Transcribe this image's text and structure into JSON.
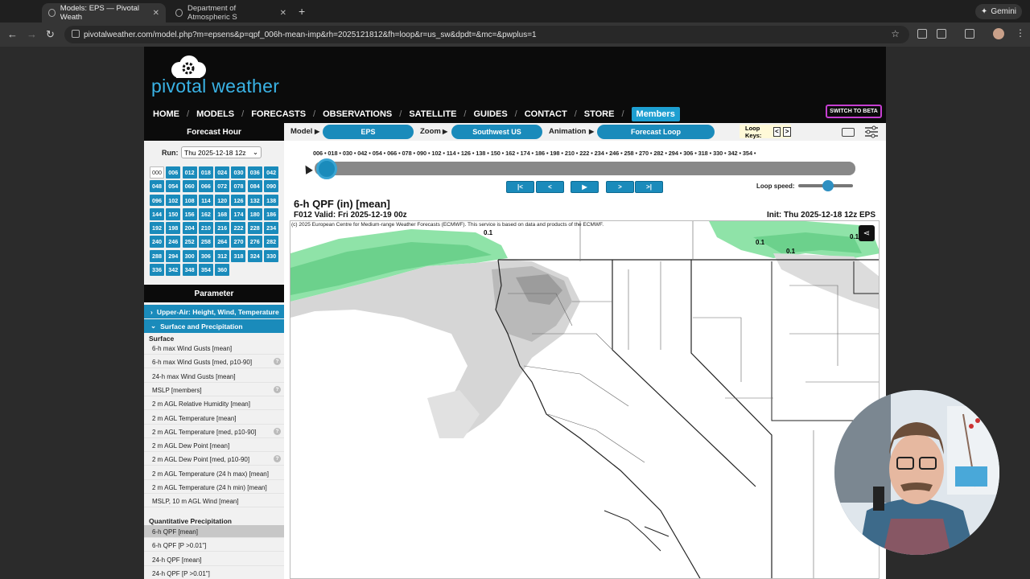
{
  "browser": {
    "tabs": [
      {
        "title": "Models: EPS — Pivotal Weath",
        "active": true
      },
      {
        "title": "Department of Atmospheric S",
        "active": false
      }
    ],
    "gemini_label": "Gemini",
    "url": "pivotalweather.com/model.php?m=epsens&p=qpf_006h-mean-imp&rh=2025121812&fh=loop&r=us_sw&dpdt=&mc=&pwplus=1"
  },
  "site": {
    "logo_text": "pivotal weather",
    "nav": [
      "HOME",
      "MODELS",
      "FORECASTS",
      "OBSERVATIONS",
      "SATELLITE",
      "GUIDES",
      "CONTACT",
      "STORE"
    ],
    "members_label": "Members",
    "switch_beta_label": "SWITCH TO BETA"
  },
  "left_panel": {
    "forecast_hour_title": "Forecast Hour",
    "run_label": "Run:",
    "run_value": "Thu 2025-12-18 12z",
    "hours": [
      "000",
      "006",
      "012",
      "018",
      "024",
      "030",
      "036",
      "042",
      "048",
      "054",
      "060",
      "066",
      "072",
      "078",
      "084",
      "090",
      "096",
      "102",
      "108",
      "114",
      "120",
      "126",
      "132",
      "138",
      "144",
      "150",
      "156",
      "162",
      "168",
      "174",
      "180",
      "186",
      "192",
      "198",
      "204",
      "210",
      "216",
      "222",
      "228",
      "234",
      "240",
      "246",
      "252",
      "258",
      "264",
      "270",
      "276",
      "282",
      "288",
      "294",
      "300",
      "306",
      "312",
      "318",
      "324",
      "330",
      "336",
      "342",
      "348",
      "354",
      "360"
    ],
    "current_hour": "000",
    "parameter_title": "Parameter",
    "categories": [
      {
        "label": "Upper-Air: Height, Wind, Temperature",
        "expanded": false
      },
      {
        "label": "Surface and Precipitation",
        "expanded": true
      }
    ],
    "surface_heading": "Surface",
    "surface_items": [
      {
        "label": "6-h max Wind Gusts [mean]",
        "help": false
      },
      {
        "label": "6-h max Wind Gusts [med, p10-90]",
        "help": true
      },
      {
        "label": "24-h max Wind Gusts [mean]",
        "help": false
      },
      {
        "label": "MSLP [members]",
        "help": true
      },
      {
        "label": "2 m AGL Relative Humidity [mean]",
        "help": false
      },
      {
        "label": "2 m AGL Temperature [mean]",
        "help": false
      },
      {
        "label": "2 m AGL Temperature [med, p10-90]",
        "help": true
      },
      {
        "label": "2 m AGL Dew Point [mean]",
        "help": false
      },
      {
        "label": "2 m AGL Dew Point [med, p10-90]",
        "help": true
      },
      {
        "label": "2 m AGL Temperature (24 h max) [mean]",
        "help": false
      },
      {
        "label": "2 m AGL Temperature (24 h min) [mean]",
        "help": false
      },
      {
        "label": "MSLP, 10 m AGL Wind [mean]",
        "help": false
      }
    ],
    "precip_heading": "Quantitative Precipitation",
    "precip_items": [
      {
        "label": "6-h QPF [mean]",
        "selected": true
      },
      {
        "label": "6-h QPF [P >0.01\"]",
        "selected": false
      },
      {
        "label": "24-h QPF [mean]",
        "selected": false
      },
      {
        "label": "24-h QPF [P >0.01\"]",
        "selected": false
      }
    ],
    "help_glyph": "?"
  },
  "controls": {
    "model_label": "Model",
    "model_value": "EPS",
    "zoom_label": "Zoom",
    "zoom_value": "Southwest US",
    "animation_label": "Animation",
    "animation_value": "Forecast Loop",
    "loop_keys_label": "Loop Keys:",
    "loop_key_prev": "<",
    "loop_key_next": ">",
    "frame_list": "006 • 018 • 030 • 042 • 054 • 066 • 078 • 090 • 102 • 114 • 126 • 138 • 150 • 162 • 174 • 186 • 198 • 210 • 222 • 234 • 246 • 258 • 270 • 282 • 294 • 306 • 318 • 330 • 342 • 354 •",
    "loop_progress": 0.0,
    "player_buttons": [
      "|<",
      "<",
      "▶",
      ">",
      ">|"
    ],
    "loop_speed_label": "Loop speed:",
    "loop_speed": 0.55
  },
  "map": {
    "title": "6-h QPF (in) [mean]",
    "valid": "F012 Valid: Fri 2025-12-19 00z",
    "init": "Init: Thu 2025-12-18 12z EPS",
    "copyright": "(c) 2025 European Centre for Medium-range Weather Forecasts (ECMWF). This service is based on data and products of the ECMWF.",
    "contour_labels": [
      "0.1",
      "0.1",
      "0.1",
      "0.1"
    ],
    "colors": {
      "precip_green": "#7fdc9a",
      "shade_gray": "#c9c9c9",
      "accent": "#1a8bbb"
    }
  }
}
